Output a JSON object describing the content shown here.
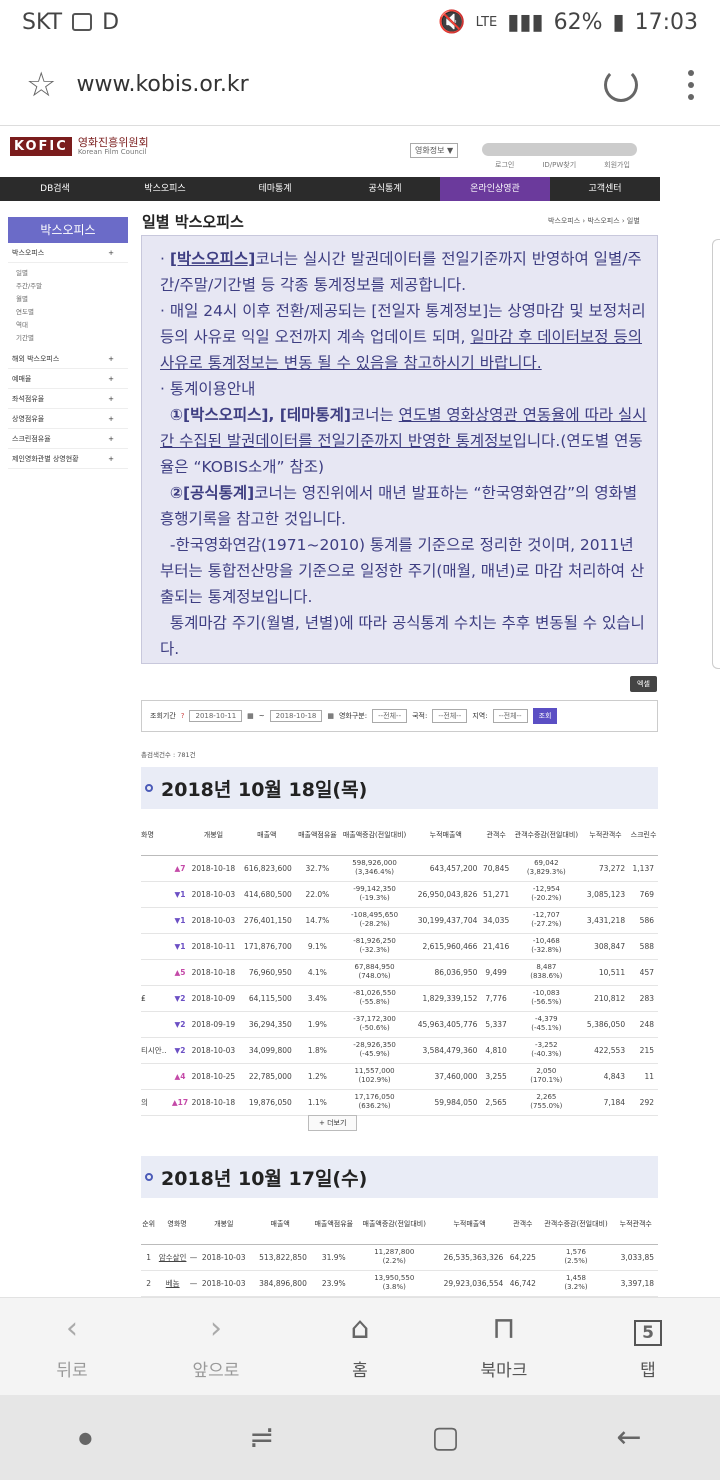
{
  "status": {
    "carrier": "SKT",
    "letter": "D",
    "lte": "LTE",
    "battery": "62%",
    "time": "17:03"
  },
  "browser": {
    "url": "www.kobis.or.kr"
  },
  "site": {
    "logo_box": "KOFIC",
    "logo_kr": "영화진흥위원회",
    "logo_en": "Korean Film Council",
    "header_select": "영화정보 ▼",
    "header_links": [
      "로그인",
      "ID/PW찾기",
      "회원가입"
    ],
    "gnb": [
      "DB검색",
      "박스오피스",
      "테마통계",
      "공식통계",
      "온라인상영관",
      "고객센터"
    ]
  },
  "lnb": {
    "title": "박스오피스",
    "main": "박스오피스",
    "subs": [
      "일별",
      "주간/주말",
      "월별",
      "연도별",
      "역대",
      "기간별"
    ],
    "items": [
      "해외 박스오피스",
      "예매율",
      "좌석점유율",
      "상영점유율",
      "스크린점유율",
      "제인영화관별 상영현황"
    ]
  },
  "page": {
    "title": "일별 박스오피스",
    "breadcrumb": "박스오피스 › 박스오피스 › 일별"
  },
  "notice": {
    "l1a": "[박스오피스]",
    "l1b": "코너는 실시간 발권데이터를 전일기준까지 반영하여 일별/주간/주말/기간별 등 각종 통계정보를 제공합니다.",
    "l2a": "매일 24시 이후 전환/제공되는 [전일자 통계정보]는 상영마감 및 보정처리 등의 사유로 익일 오전까지 계속 업데이트 되며, ",
    "l2b": "일마감 후 데이터보정 등의 사유로 통계정보는 변동 될 수 있음을 참고하시기 바랍니다.",
    "l3": "통계이용안내",
    "l4a": "①[박스오피스], [테마통계]",
    "l4b": "코너는 ",
    "l4c": "연도별 영화상영관 연동율에 따라 실시간 수집된 발권데이터를 전일기준까지 반영한 통계정보",
    "l4d": "입니다.(연도별 연동율은 “KOBIS소개” 참조)",
    "l5a": "②[공식통계]",
    "l5b": "코너는 영진위에서 매년 발표하는 “한국영화연감”의 영화별 흥행기록을 참고한 것입니다.",
    "l6": "-한국영화연감(1971~2010) 통계를 기준으로 정리한 것이며, 2011년부터는 통합전산망을 기준으로 일정한 주기(매월, 매년)로 마감 처리하여 산출되는 통계정보입니다.",
    "l7": "통계마감 주기(월별, 년별)에 따라 공식통계 수치는 추후 변동될 수 있습니다."
  },
  "excel": "엑셀",
  "filter": {
    "period_label": "조회기간",
    "date_from": "2018-10-11",
    "date_to": "2018-10-18",
    "type_label": "영화구분:",
    "all": "--전체--",
    "nation_label": "국적:",
    "region_label": "지역:",
    "search": "조회"
  },
  "count": "총검색건수 : 781건",
  "day1": {
    "title": "2018년 10월 18일(목)",
    "headers": [
      "화명",
      "개봉일",
      "매출액",
      "매출액점유율",
      "매출액증감(전일대비)",
      "누적매출액",
      "관객수",
      "관객수증감(전일대비)",
      "누적관객수",
      "스크린수"
    ],
    "rows": [
      {
        "name": "",
        "rank": "7",
        "up": true,
        "open": "2018-10-18",
        "sales": "616,823,600",
        "share": "32.7%",
        "chg": "598,926,000",
        "chgp": "(3,346.4%)",
        "acc": "643,457,200",
        "aud": "70,845",
        "achg": "69,042",
        "achgp": "(3,829.3%)",
        "accaud": "73,272",
        "scr": "1,137"
      },
      {
        "name": "",
        "rank": "1",
        "up": false,
        "open": "2018-10-03",
        "sales": "414,680,500",
        "share": "22.0%",
        "chg": "-99,142,350",
        "chgp": "(-19.3%)",
        "acc": "26,950,043,826",
        "aud": "51,271",
        "achg": "-12,954",
        "achgp": "(-20.2%)",
        "accaud": "3,085,123",
        "scr": "769"
      },
      {
        "name": "",
        "rank": "1",
        "up": false,
        "open": "2018-10-03",
        "sales": "276,401,150",
        "share": "14.7%",
        "chg": "-108,495,650",
        "chgp": "(-28.2%)",
        "acc": "30,199,437,704",
        "aud": "34,035",
        "achg": "-12,707",
        "achgp": "(-27.2%)",
        "accaud": "3,431,218",
        "scr": "586"
      },
      {
        "name": "",
        "rank": "1",
        "up": false,
        "open": "2018-10-11",
        "sales": "171,876,700",
        "share": "9.1%",
        "chg": "-81,926,250",
        "chgp": "(-32.3%)",
        "acc": "2,615,960,466",
        "aud": "21,416",
        "achg": "-10,468",
        "achgp": "(-32.8%)",
        "accaud": "308,847",
        "scr": "588"
      },
      {
        "name": "",
        "rank": "5",
        "up": true,
        "open": "2018-10-18",
        "sales": "76,960,950",
        "share": "4.1%",
        "chg": "67,884,950",
        "chgp": "(748.0%)",
        "acc": "86,036,950",
        "aud": "9,499",
        "achg": "8,487",
        "achgp": "(838.6%)",
        "accaud": "10,511",
        "scr": "457"
      },
      {
        "name": "₤",
        "rank": "2",
        "up": false,
        "open": "2018-10-09",
        "sales": "64,115,500",
        "share": "3.4%",
        "chg": "-81,026,550",
        "chgp": "(-55.8%)",
        "acc": "1,829,339,152",
        "aud": "7,776",
        "achg": "-10,083",
        "achgp": "(-56.5%)",
        "accaud": "210,812",
        "scr": "283"
      },
      {
        "name": "",
        "rank": "2",
        "up": false,
        "open": "2018-09-19",
        "sales": "36,294,350",
        "share": "1.9%",
        "chg": "-37,172,300",
        "chgp": "(-50.6%)",
        "acc": "45,963,405,776",
        "aud": "5,337",
        "achg": "-4,379",
        "achgp": "(-45.1%)",
        "accaud": "5,386,050",
        "scr": "248"
      },
      {
        "name": "티시안..",
        "rank": "2",
        "up": false,
        "open": "2018-10-03",
        "sales": "34,099,800",
        "share": "1.8%",
        "chg": "-28,926,350",
        "chgp": "(-45.9%)",
        "acc": "3,584,479,360",
        "aud": "4,810",
        "achg": "-3,252",
        "achgp": "(-40.3%)",
        "accaud": "422,553",
        "scr": "215"
      },
      {
        "name": "",
        "rank": "4",
        "up": true,
        "open": "2018-10-25",
        "sales": "22,785,000",
        "share": "1.2%",
        "chg": "11,557,000",
        "chgp": "(102.9%)",
        "acc": "37,460,000",
        "aud": "3,255",
        "achg": "2,050",
        "achgp": "(170.1%)",
        "accaud": "4,843",
        "scr": "11"
      },
      {
        "name": "의",
        "rank": "17",
        "up": true,
        "open": "2018-10-18",
        "sales": "19,876,050",
        "share": "1.1%",
        "chg": "17,176,050",
        "chgp": "(636.2%)",
        "acc": "59,984,050",
        "aud": "2,565",
        "achg": "2,265",
        "achgp": "(755.0%)",
        "accaud": "7,184",
        "scr": "292"
      }
    ],
    "more": "+ 더보기"
  },
  "day2": {
    "title": "2018년 10월 17일(수)",
    "headers": [
      "순위",
      "영화명",
      "개봉일",
      "매출액",
      "매출액점유율",
      "매출액증감(전일대비)",
      "누적매출액",
      "관객수",
      "관객수증감(전일대비)",
      "누적관객수"
    ],
    "rows": [
      {
        "rank": "1",
        "name": "암수살인",
        "dash": "—",
        "open": "2018-10-03",
        "sales": "513,822,850",
        "share": "31.9%",
        "chg": "11,287,800",
        "chgp": "(2.2%)",
        "acc": "26,535,363,326",
        "aud": "64,225",
        "achg": "1,576",
        "achgp": "(2.5%)",
        "accaud": "3,033,85"
      },
      {
        "rank": "2",
        "name": "베놈",
        "dash": "—",
        "open": "2018-10-03",
        "sales": "384,896,800",
        "share": "23.9%",
        "chg": "13,950,550",
        "chgp": "(3.8%)",
        "acc": "29,923,036,554",
        "aud": "46,742",
        "achg": "1,458",
        "achgp": "(3.2%)",
        "accaud": "3,397,18"
      }
    ]
  },
  "bottom_nav": [
    {
      "label": "뒤로",
      "icon": "‹"
    },
    {
      "label": "앞으로",
      "icon": "›"
    },
    {
      "label": "홈",
      "icon": "⌂"
    },
    {
      "label": "북마크",
      "icon": "⊓"
    },
    {
      "label": "탭",
      "icon": "5"
    }
  ]
}
